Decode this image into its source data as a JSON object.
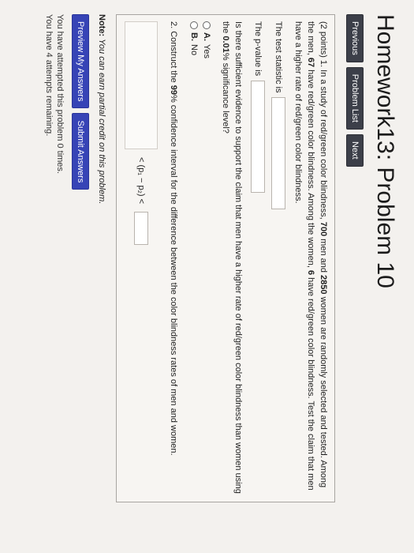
{
  "page": {
    "title": "Homework13: Problem 10"
  },
  "nav": {
    "previous": "Previous",
    "problem_list": "Problem List",
    "next": "Next"
  },
  "problem": {
    "intro_prefix": "(2 points) 1. In a study of red/green color blindness,",
    "men_count": "700",
    "intro_mid1": " men and ",
    "women_count": "2850",
    "intro_mid2": " women are randomly selected and tested. Among the men, ",
    "men_blind": "67",
    "intro_mid3": " have red/green color blindness. Among the women, ",
    "women_blind": "6",
    "intro_suffix": " have red/green color blindness. Test the claim that men have a higher rate of red/green color blindness.",
    "test_stat_label": "The test statistic is",
    "p_value_label": "The p-value is",
    "question": "Is there sufficient evidence to support the claim that men have a higher rate of red/green color blindness than women using the ",
    "significance": "0.01",
    "question_suffix": "% significance level?",
    "choices": [
      {
        "label": "A.",
        "text": "Yes"
      },
      {
        "label": "B.",
        "text": "No"
      }
    ],
    "part2_prefix": "2. Construct the ",
    "confidence": "99",
    "part2_suffix": "% confidence interval for the difference between the color blindness rates of men and women.",
    "ci_expression": "< (p₁ − p₂) <"
  },
  "note": {
    "label": "Note:",
    "text": "You can earn partial credit on this problem."
  },
  "actions": {
    "preview": "Preview My Answers",
    "submit": "Submit Answers"
  },
  "status": {
    "attempted": "You have attempted this problem 0 times.",
    "remaining": "You have 4 attempts remaining."
  }
}
